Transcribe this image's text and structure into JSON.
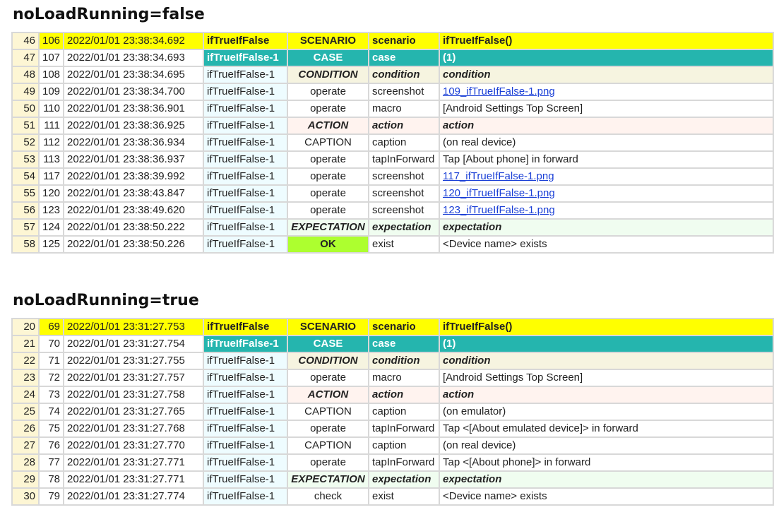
{
  "sections": [
    {
      "title": "noLoadRunning=false",
      "rows": [
        {
          "no": "46",
          "seq": "106",
          "time": "2022/01/01 23:38:34.692",
          "name": "ifTrueIfFalse",
          "kind": "SCENARIO",
          "op": "scenario",
          "desc": "ifTrueIfFalse()",
          "style": "scenario",
          "link": false
        },
        {
          "no": "47",
          "seq": "107",
          "time": "2022/01/01 23:38:34.693",
          "name": "ifTrueIfFalse-1",
          "kind": "CASE",
          "op": "case",
          "desc": "(1)",
          "style": "case",
          "link": false
        },
        {
          "no": "48",
          "seq": "108",
          "time": "2022/01/01 23:38:34.695",
          "name": "ifTrueIfFalse-1",
          "kind": "CONDITION",
          "op": "condition",
          "desc": "condition",
          "style": "condition",
          "link": false
        },
        {
          "no": "49",
          "seq": "109",
          "time": "2022/01/01 23:38:34.700",
          "name": "ifTrueIfFalse-1",
          "kind": "operate",
          "op": "screenshot",
          "desc": "109_ifTrueIfFalse-1.png",
          "style": "normal",
          "link": true
        },
        {
          "no": "50",
          "seq": "110",
          "time": "2022/01/01 23:38:36.901",
          "name": "ifTrueIfFalse-1",
          "kind": "operate",
          "op": "macro",
          "desc": "[Android Settings Top Screen]",
          "style": "normal",
          "link": false
        },
        {
          "no": "51",
          "seq": "111",
          "time": "2022/01/01 23:38:36.925",
          "name": "ifTrueIfFalse-1",
          "kind": "ACTION",
          "op": "action",
          "desc": "action",
          "style": "action",
          "link": false
        },
        {
          "no": "52",
          "seq": "112",
          "time": "2022/01/01 23:38:36.934",
          "name": "ifTrueIfFalse-1",
          "kind": "CAPTION",
          "op": "caption",
          "desc": "(on real device)",
          "style": "normal",
          "link": false
        },
        {
          "no": "53",
          "seq": "113",
          "time": "2022/01/01 23:38:36.937",
          "name": "ifTrueIfFalse-1",
          "kind": "operate",
          "op": "tapInForward",
          "desc": "Tap [About phone] in forward",
          "style": "normal",
          "link": false
        },
        {
          "no": "54",
          "seq": "117",
          "time": "2022/01/01 23:38:39.992",
          "name": "ifTrueIfFalse-1",
          "kind": "operate",
          "op": "screenshot",
          "desc": "117_ifTrueIfFalse-1.png",
          "style": "normal",
          "link": true
        },
        {
          "no": "55",
          "seq": "120",
          "time": "2022/01/01 23:38:43.847",
          "name": "ifTrueIfFalse-1",
          "kind": "operate",
          "op": "screenshot",
          "desc": "120_ifTrueIfFalse-1.png",
          "style": "normal",
          "link": true
        },
        {
          "no": "56",
          "seq": "123",
          "time": "2022/01/01 23:38:49.620",
          "name": "ifTrueIfFalse-1",
          "kind": "operate",
          "op": "screenshot",
          "desc": "123_ifTrueIfFalse-1.png",
          "style": "normal",
          "link": true
        },
        {
          "no": "57",
          "seq": "124",
          "time": "2022/01/01 23:38:50.222",
          "name": "ifTrueIfFalse-1",
          "kind": "EXPECTATION",
          "op": "expectation",
          "desc": "expectation",
          "style": "expectation",
          "link": false
        },
        {
          "no": "58",
          "seq": "125",
          "time": "2022/01/01 23:38:50.226",
          "name": "ifTrueIfFalse-1",
          "kind": "OK",
          "op": "exist",
          "desc": "<Device name> exists",
          "style": "ok",
          "link": false
        }
      ]
    },
    {
      "title": "noLoadRunning=true",
      "rows": [
        {
          "no": "20",
          "seq": "69",
          "time": "2022/01/01 23:31:27.753",
          "name": "ifTrueIfFalse",
          "kind": "SCENARIO",
          "op": "scenario",
          "desc": "ifTrueIfFalse()",
          "style": "scenario",
          "link": false
        },
        {
          "no": "21",
          "seq": "70",
          "time": "2022/01/01 23:31:27.754",
          "name": "ifTrueIfFalse-1",
          "kind": "CASE",
          "op": "case",
          "desc": "(1)",
          "style": "case",
          "link": false
        },
        {
          "no": "22",
          "seq": "71",
          "time": "2022/01/01 23:31:27.755",
          "name": "ifTrueIfFalse-1",
          "kind": "CONDITION",
          "op": "condition",
          "desc": "condition",
          "style": "condition",
          "link": false
        },
        {
          "no": "23",
          "seq": "72",
          "time": "2022/01/01 23:31:27.757",
          "name": "ifTrueIfFalse-1",
          "kind": "operate",
          "op": "macro",
          "desc": "[Android Settings Top Screen]",
          "style": "normal",
          "link": false
        },
        {
          "no": "24",
          "seq": "73",
          "time": "2022/01/01 23:31:27.758",
          "name": "ifTrueIfFalse-1",
          "kind": "ACTION",
          "op": "action",
          "desc": "action",
          "style": "action",
          "link": false
        },
        {
          "no": "25",
          "seq": "74",
          "time": "2022/01/01 23:31:27.765",
          "name": "ifTrueIfFalse-1",
          "kind": "CAPTION",
          "op": "caption",
          "desc": "(on emulator)",
          "style": "normal",
          "link": false
        },
        {
          "no": "26",
          "seq": "75",
          "time": "2022/01/01 23:31:27.768",
          "name": "ifTrueIfFalse-1",
          "kind": "operate",
          "op": "tapInForward",
          "desc": "Tap <[About emulated device]> in forward",
          "style": "normal",
          "link": false
        },
        {
          "no": "27",
          "seq": "76",
          "time": "2022/01/01 23:31:27.770",
          "name": "ifTrueIfFalse-1",
          "kind": "CAPTION",
          "op": "caption",
          "desc": "(on real device)",
          "style": "normal",
          "link": false
        },
        {
          "no": "28",
          "seq": "77",
          "time": "2022/01/01 23:31:27.771",
          "name": "ifTrueIfFalse-1",
          "kind": "operate",
          "op": "tapInForward",
          "desc": "Tap <[About phone]> in forward",
          "style": "normal",
          "link": false
        },
        {
          "no": "29",
          "seq": "78",
          "time": "2022/01/01 23:31:27.771",
          "name": "ifTrueIfFalse-1",
          "kind": "EXPECTATION",
          "op": "expectation",
          "desc": "expectation",
          "style": "expectation",
          "link": false
        },
        {
          "no": "30",
          "seq": "79",
          "time": "2022/01/01 23:31:27.774",
          "name": "ifTrueIfFalse-1",
          "kind": "check",
          "op": "exist",
          "desc": "<Device name> exists",
          "style": "normal",
          "link": false
        }
      ]
    }
  ]
}
